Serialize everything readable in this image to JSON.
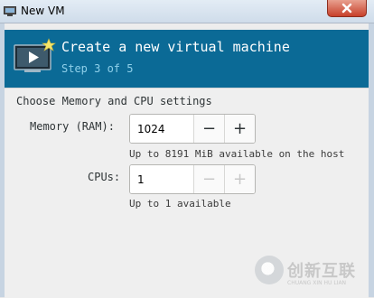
{
  "window": {
    "title": "New VM"
  },
  "banner": {
    "heading": "Create a new virtual machine",
    "step": "Step 3 of 5"
  },
  "section": {
    "title": "Choose Memory and CPU settings"
  },
  "memory": {
    "label": "Memory (RAM):",
    "value": "1024",
    "decrement": "−",
    "increment": "+",
    "hint": "Up to 8191 MiB available on the host"
  },
  "cpus": {
    "label": "CPUs:",
    "value": "1",
    "decrement": "−",
    "increment": "+",
    "hint": "Up to 1 available"
  },
  "watermark": {
    "text": "创新互联",
    "sub": "CHUANG XIN HU LIAN"
  }
}
